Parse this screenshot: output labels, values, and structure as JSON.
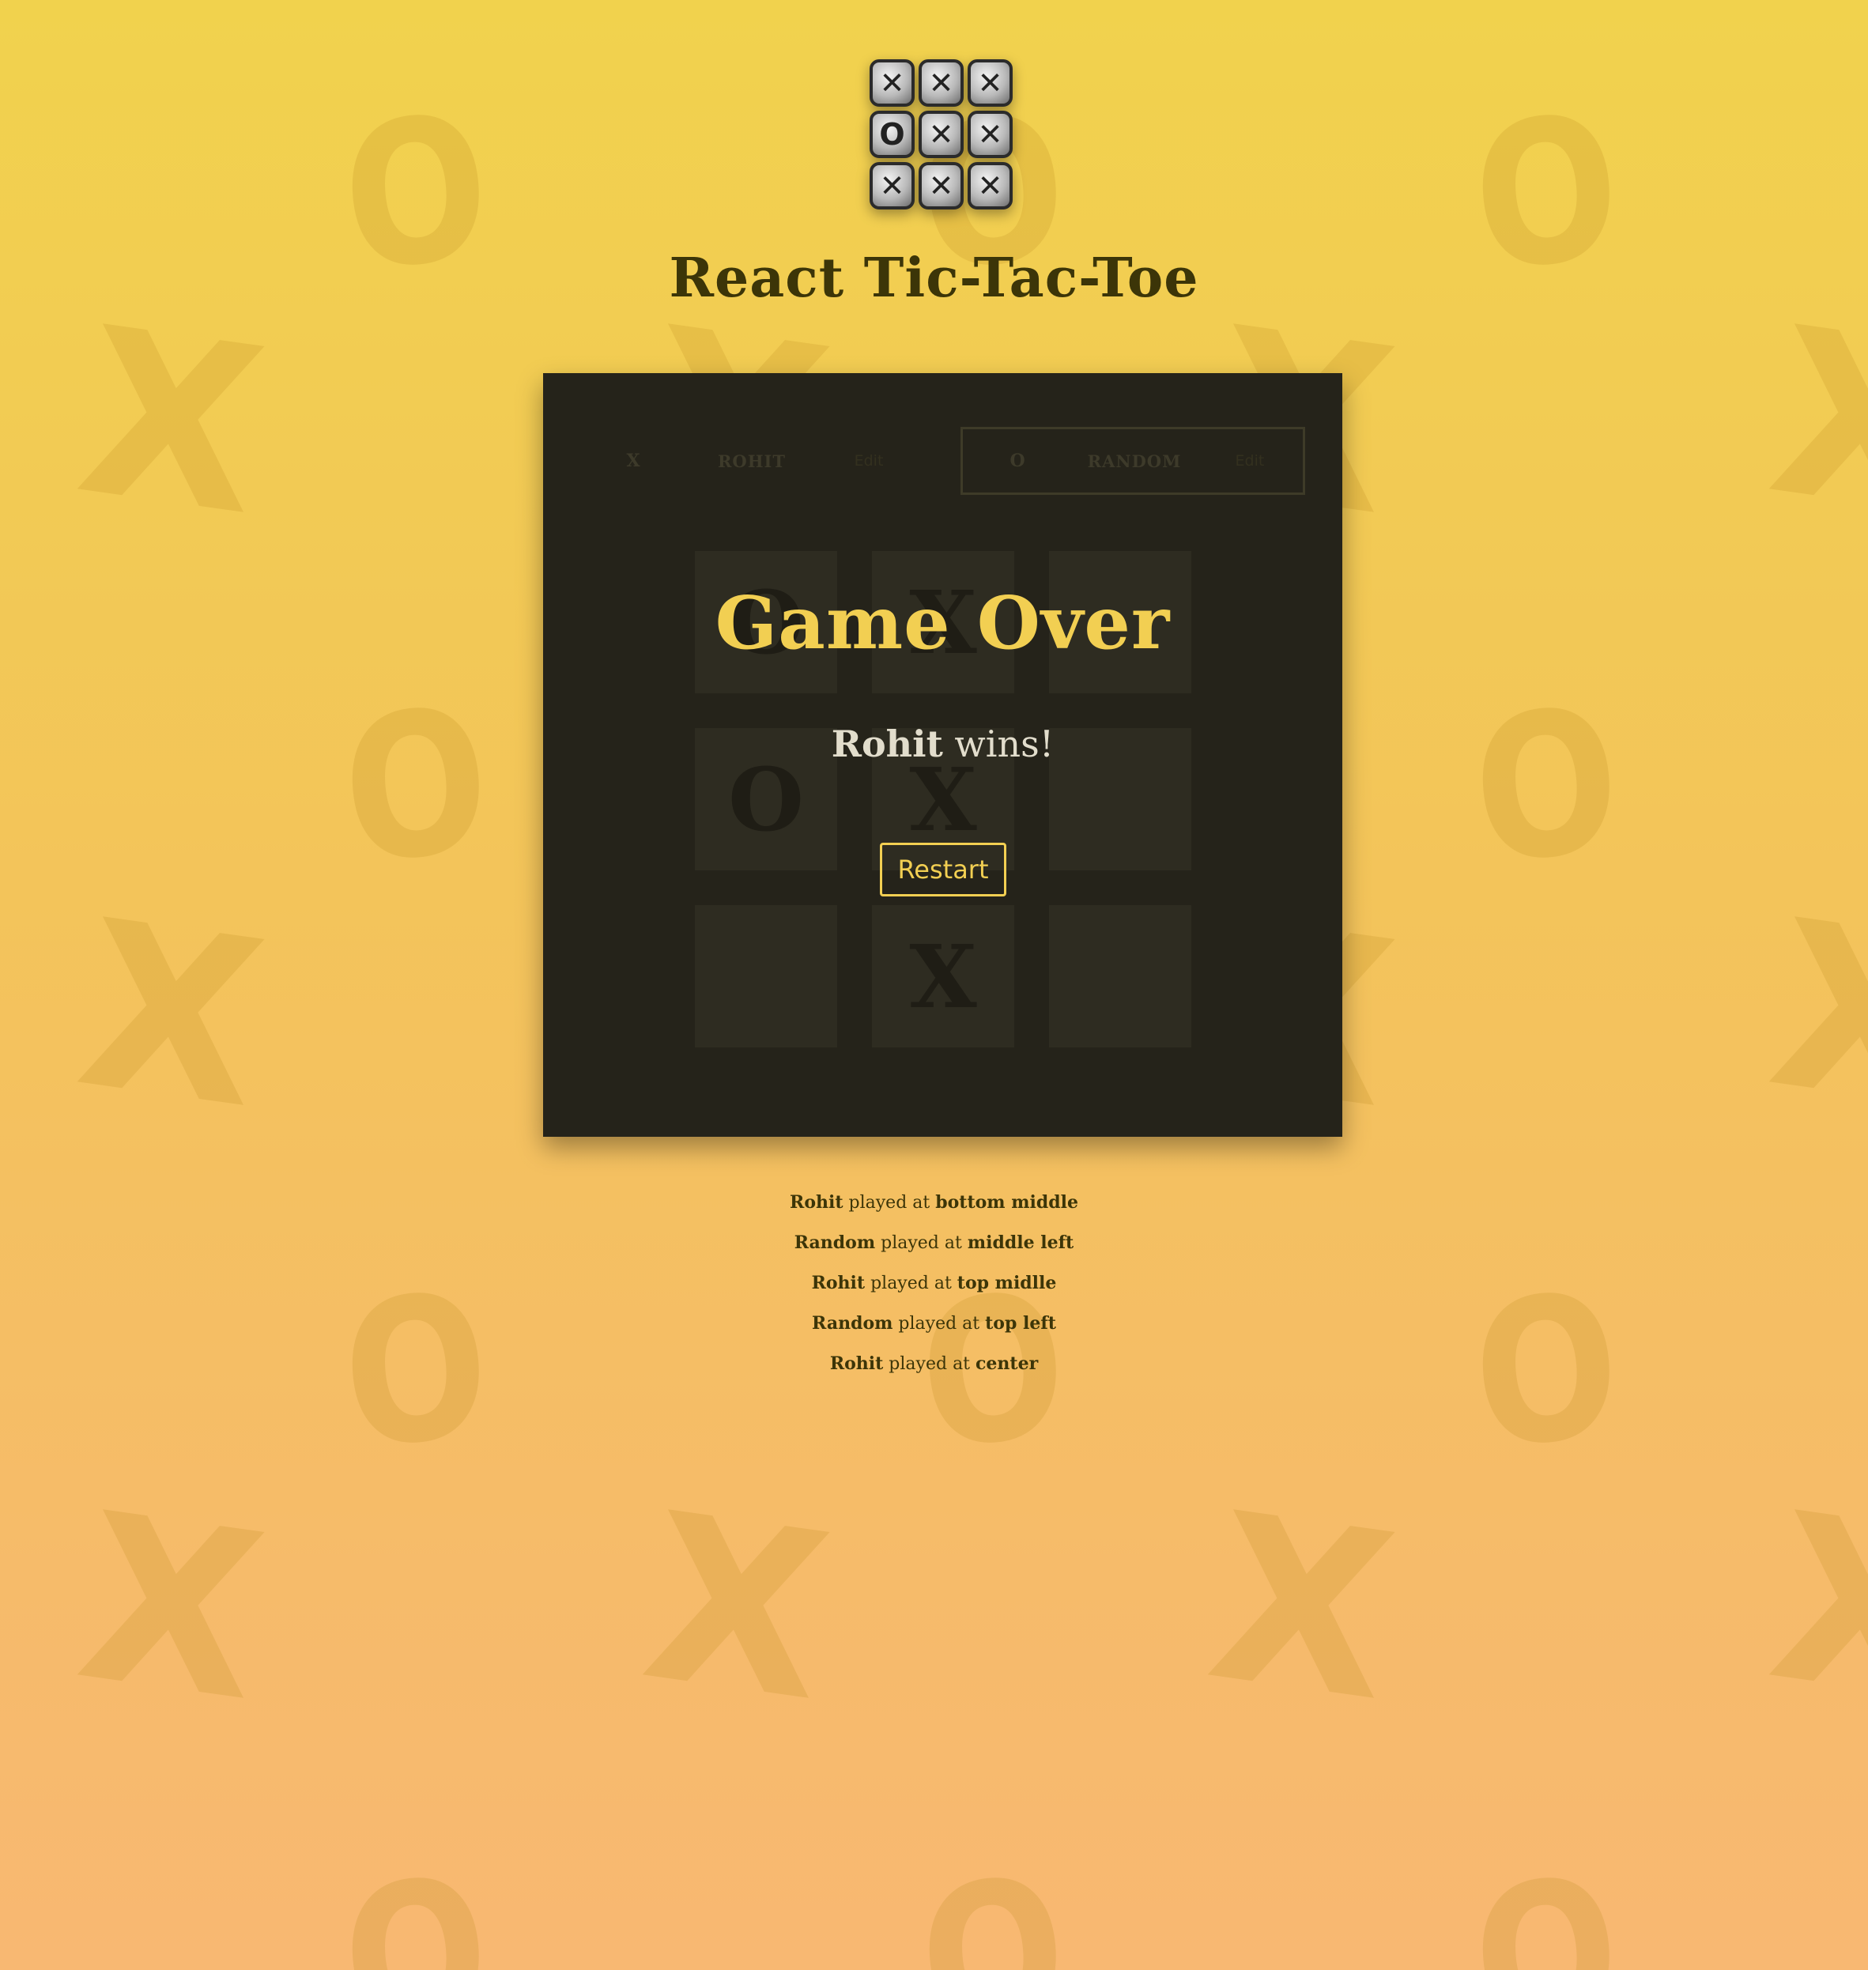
{
  "app": {
    "title": "React Tic-Tac-Toe"
  },
  "logo": {
    "tiles": [
      "✕",
      "✕",
      "✕",
      "O",
      "✕",
      "✕",
      "✕",
      "✕",
      "✕"
    ]
  },
  "players": [
    {
      "symbol": "X",
      "name": "ROHIT",
      "edit_label": "Edit",
      "active": false
    },
    {
      "symbol": "O",
      "name": "RANDOM",
      "edit_label": "Edit",
      "active": true
    }
  ],
  "board": {
    "cells": [
      "O",
      "X",
      "",
      "O",
      "X",
      "",
      "",
      "X",
      ""
    ]
  },
  "game_over": {
    "title": "Game Over",
    "winner": "Rohit",
    "result_suffix": " wins!",
    "restart_label": "Restart"
  },
  "log": [
    {
      "player": "Rohit",
      "text": " played at ",
      "position": "bottom middle"
    },
    {
      "player": "Random",
      "text": " played at ",
      "position": "middle left"
    },
    {
      "player": "Rohit",
      "text": " played at ",
      "position": "top midlle"
    },
    {
      "player": "Random",
      "text": " played at ",
      "position": "top left"
    },
    {
      "player": "Rohit",
      "text": " played at ",
      "position": "center"
    }
  ],
  "colors": {
    "accent": "#f2cf52",
    "panel": "#25231a",
    "title": "#3c3508"
  }
}
